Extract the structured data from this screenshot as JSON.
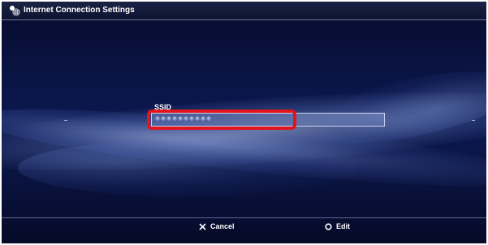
{
  "window": {
    "title": "Internet Connection Settings",
    "title_icon": "network-globe-icon"
  },
  "ssid": {
    "label": "SSID",
    "value": "**********"
  },
  "bottom_buttons": {
    "cancel": {
      "icon": "cross-button-icon",
      "label": "Cancel"
    },
    "edit": {
      "icon": "circle-button-icon",
      "label": "Edit"
    }
  },
  "colors": {
    "highlight": "#e3141c",
    "background": "#0a1444"
  }
}
